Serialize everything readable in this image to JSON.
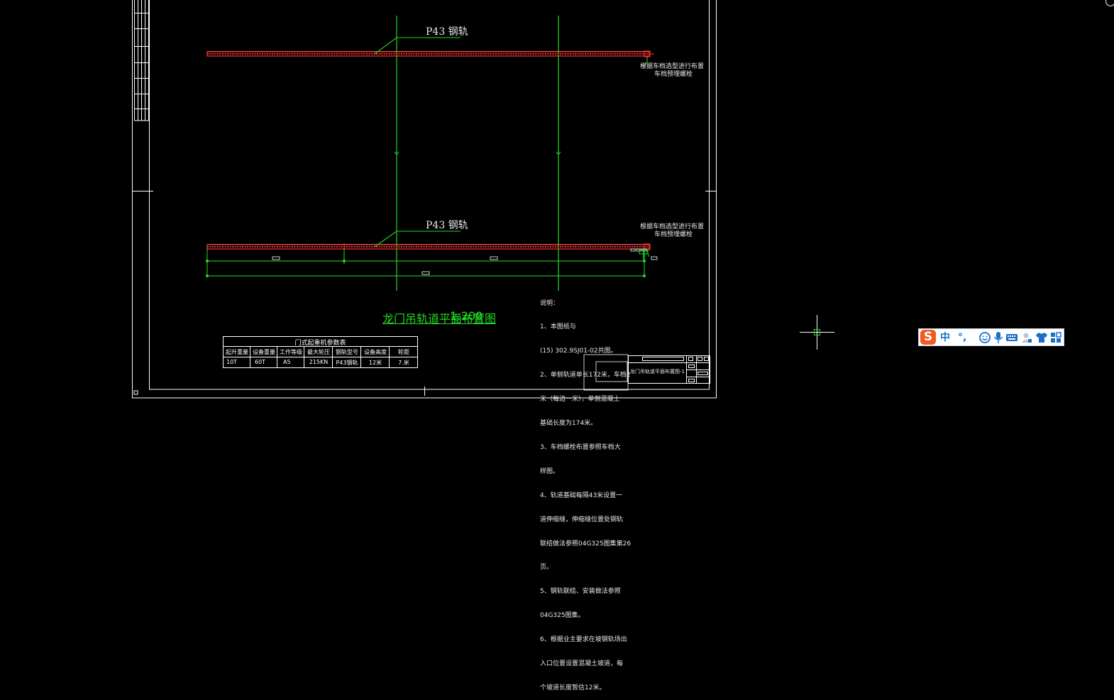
{
  "drawing": {
    "rail_label_top": "P43 钢轨",
    "rail_label_bottom": "P43 钢轨",
    "anchor_note_top": [
      "根据车档选型进行布置",
      "车档预埋螺栓"
    ],
    "anchor_note_bottom": [
      "根据车档选型进行布置",
      "车档预埋螺栓"
    ],
    "layout_title": "龙门吊轨道平面布置图",
    "layout_title_overlap": "1:200",
    "notes": [
      "说明：",
      "1、本图纸与",
      "(15) 302.9SJ01-02共图。",
      "2、单侧轨道单长172米，车档2",
      "米（每边一米），单侧混凝土",
      "基础长度为174米。",
      "3、车档螺栓布置参照车档大",
      "样图。",
      "4、轨道基础每隔43米设置一",
      "道伸缩缝，伸缩缝位置处钢轨",
      "联结做法参照04G325图集第26",
      "页。",
      "5、钢轨联结、安装做法参照",
      "04G325图集。",
      "6、根据业主要求在坡钢轨场出",
      "入口位置设置混凝土坡道，每",
      "个坡道长度暂估12米。"
    ],
    "sheet_title": "龙门吊轨道平面布置图-1"
  },
  "crane_table": {
    "title": "门式起重机参数表",
    "headers": [
      "起升重量",
      "设备重量",
      "工作等级",
      "最大轮压",
      "钢轨型号",
      "设备高度",
      "轮距"
    ],
    "row": [
      "10T",
      "60T",
      "A5",
      "215KN",
      "P43钢轨",
      "12米",
      "7.米"
    ]
  },
  "ime": {
    "logo": "S",
    "mode": "中",
    "punct": "°,",
    "icons": [
      "emoji-icon",
      "microphone-icon",
      "keyboard-icon",
      "user-icon",
      "shirt-icon",
      "grid-icon"
    ]
  },
  "colors": {
    "background": "#000000",
    "line_white": "#ffffff",
    "line_green": "#22dd22",
    "rail_red": "#ff3030",
    "ime_blue": "#1a6fc9",
    "ime_orange": "#f15a22"
  }
}
